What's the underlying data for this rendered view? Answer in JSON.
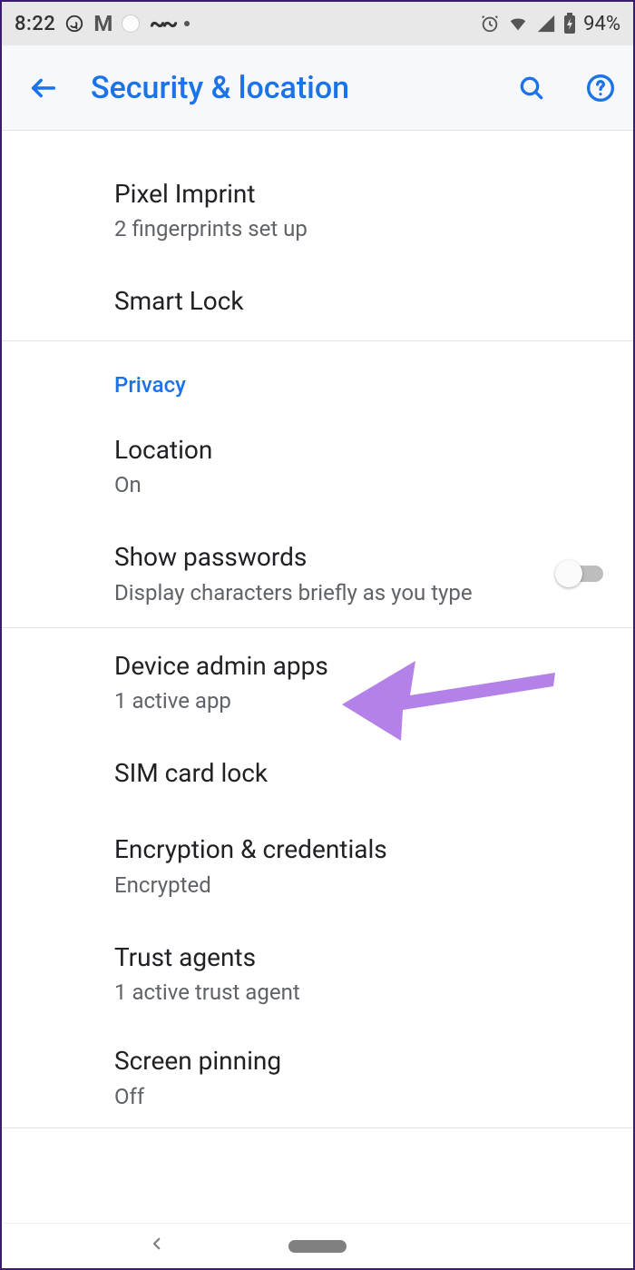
{
  "status": {
    "time": "8:22",
    "battery": "94%"
  },
  "header": {
    "title": "Security & location"
  },
  "sections": {
    "top": {
      "pixel_imprint": {
        "title": "Pixel Imprint",
        "sub": "2 fingerprints set up"
      },
      "smart_lock": {
        "title": "Smart Lock"
      }
    },
    "privacy": {
      "heading": "Privacy",
      "location": {
        "title": "Location",
        "sub": "On"
      },
      "show_passwords": {
        "title": "Show passwords",
        "sub": "Display characters briefly as you type"
      }
    },
    "more": {
      "device_admin": {
        "title": "Device admin apps",
        "sub": "1 active app"
      },
      "sim_lock": {
        "title": "SIM card lock"
      },
      "encryption": {
        "title": "Encryption & credentials",
        "sub": "Encrypted"
      },
      "trust_agents": {
        "title": "Trust agents",
        "sub": "1 active trust agent"
      },
      "screen_pin": {
        "title": "Screen pinning",
        "sub": "Off"
      }
    }
  }
}
